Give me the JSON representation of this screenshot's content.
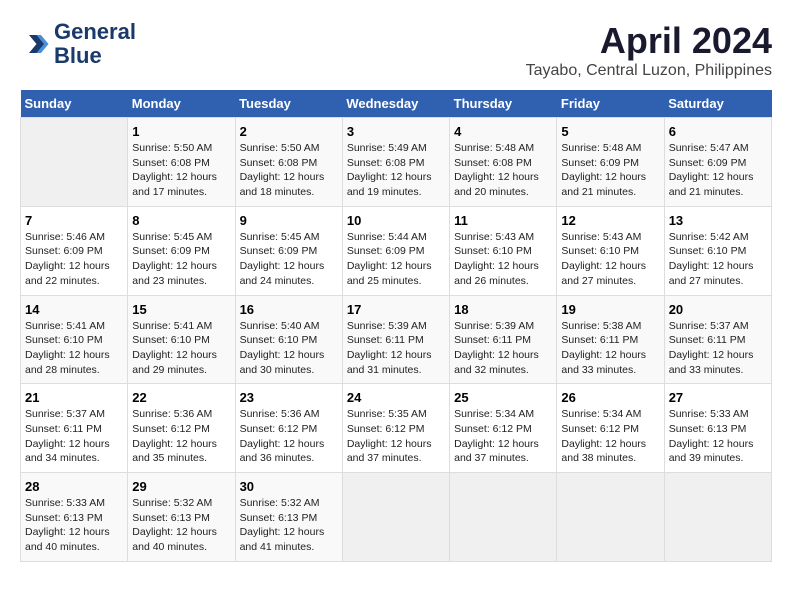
{
  "header": {
    "logo_line1": "General",
    "logo_line2": "Blue",
    "month": "April 2024",
    "location": "Tayabo, Central Luzon, Philippines"
  },
  "days_of_week": [
    "Sunday",
    "Monday",
    "Tuesday",
    "Wednesday",
    "Thursday",
    "Friday",
    "Saturday"
  ],
  "weeks": [
    [
      {
        "day": "",
        "info": ""
      },
      {
        "day": "1",
        "info": "Sunrise: 5:50 AM\nSunset: 6:08 PM\nDaylight: 12 hours\nand 17 minutes."
      },
      {
        "day": "2",
        "info": "Sunrise: 5:50 AM\nSunset: 6:08 PM\nDaylight: 12 hours\nand 18 minutes."
      },
      {
        "day": "3",
        "info": "Sunrise: 5:49 AM\nSunset: 6:08 PM\nDaylight: 12 hours\nand 19 minutes."
      },
      {
        "day": "4",
        "info": "Sunrise: 5:48 AM\nSunset: 6:08 PM\nDaylight: 12 hours\nand 20 minutes."
      },
      {
        "day": "5",
        "info": "Sunrise: 5:48 AM\nSunset: 6:09 PM\nDaylight: 12 hours\nand 21 minutes."
      },
      {
        "day": "6",
        "info": "Sunrise: 5:47 AM\nSunset: 6:09 PM\nDaylight: 12 hours\nand 21 minutes."
      }
    ],
    [
      {
        "day": "7",
        "info": "Sunrise: 5:46 AM\nSunset: 6:09 PM\nDaylight: 12 hours\nand 22 minutes."
      },
      {
        "day": "8",
        "info": "Sunrise: 5:45 AM\nSunset: 6:09 PM\nDaylight: 12 hours\nand 23 minutes."
      },
      {
        "day": "9",
        "info": "Sunrise: 5:45 AM\nSunset: 6:09 PM\nDaylight: 12 hours\nand 24 minutes."
      },
      {
        "day": "10",
        "info": "Sunrise: 5:44 AM\nSunset: 6:09 PM\nDaylight: 12 hours\nand 25 minutes."
      },
      {
        "day": "11",
        "info": "Sunrise: 5:43 AM\nSunset: 6:10 PM\nDaylight: 12 hours\nand 26 minutes."
      },
      {
        "day": "12",
        "info": "Sunrise: 5:43 AM\nSunset: 6:10 PM\nDaylight: 12 hours\nand 27 minutes."
      },
      {
        "day": "13",
        "info": "Sunrise: 5:42 AM\nSunset: 6:10 PM\nDaylight: 12 hours\nand 27 minutes."
      }
    ],
    [
      {
        "day": "14",
        "info": "Sunrise: 5:41 AM\nSunset: 6:10 PM\nDaylight: 12 hours\nand 28 minutes."
      },
      {
        "day": "15",
        "info": "Sunrise: 5:41 AM\nSunset: 6:10 PM\nDaylight: 12 hours\nand 29 minutes."
      },
      {
        "day": "16",
        "info": "Sunrise: 5:40 AM\nSunset: 6:10 PM\nDaylight: 12 hours\nand 30 minutes."
      },
      {
        "day": "17",
        "info": "Sunrise: 5:39 AM\nSunset: 6:11 PM\nDaylight: 12 hours\nand 31 minutes."
      },
      {
        "day": "18",
        "info": "Sunrise: 5:39 AM\nSunset: 6:11 PM\nDaylight: 12 hours\nand 32 minutes."
      },
      {
        "day": "19",
        "info": "Sunrise: 5:38 AM\nSunset: 6:11 PM\nDaylight: 12 hours\nand 33 minutes."
      },
      {
        "day": "20",
        "info": "Sunrise: 5:37 AM\nSunset: 6:11 PM\nDaylight: 12 hours\nand 33 minutes."
      }
    ],
    [
      {
        "day": "21",
        "info": "Sunrise: 5:37 AM\nSunset: 6:11 PM\nDaylight: 12 hours\nand 34 minutes."
      },
      {
        "day": "22",
        "info": "Sunrise: 5:36 AM\nSunset: 6:12 PM\nDaylight: 12 hours\nand 35 minutes."
      },
      {
        "day": "23",
        "info": "Sunrise: 5:36 AM\nSunset: 6:12 PM\nDaylight: 12 hours\nand 36 minutes."
      },
      {
        "day": "24",
        "info": "Sunrise: 5:35 AM\nSunset: 6:12 PM\nDaylight: 12 hours\nand 37 minutes."
      },
      {
        "day": "25",
        "info": "Sunrise: 5:34 AM\nSunset: 6:12 PM\nDaylight: 12 hours\nand 37 minutes."
      },
      {
        "day": "26",
        "info": "Sunrise: 5:34 AM\nSunset: 6:12 PM\nDaylight: 12 hours\nand 38 minutes."
      },
      {
        "day": "27",
        "info": "Sunrise: 5:33 AM\nSunset: 6:13 PM\nDaylight: 12 hours\nand 39 minutes."
      }
    ],
    [
      {
        "day": "28",
        "info": "Sunrise: 5:33 AM\nSunset: 6:13 PM\nDaylight: 12 hours\nand 40 minutes."
      },
      {
        "day": "29",
        "info": "Sunrise: 5:32 AM\nSunset: 6:13 PM\nDaylight: 12 hours\nand 40 minutes."
      },
      {
        "day": "30",
        "info": "Sunrise: 5:32 AM\nSunset: 6:13 PM\nDaylight: 12 hours\nand 41 minutes."
      },
      {
        "day": "",
        "info": ""
      },
      {
        "day": "",
        "info": ""
      },
      {
        "day": "",
        "info": ""
      },
      {
        "day": "",
        "info": ""
      }
    ]
  ]
}
